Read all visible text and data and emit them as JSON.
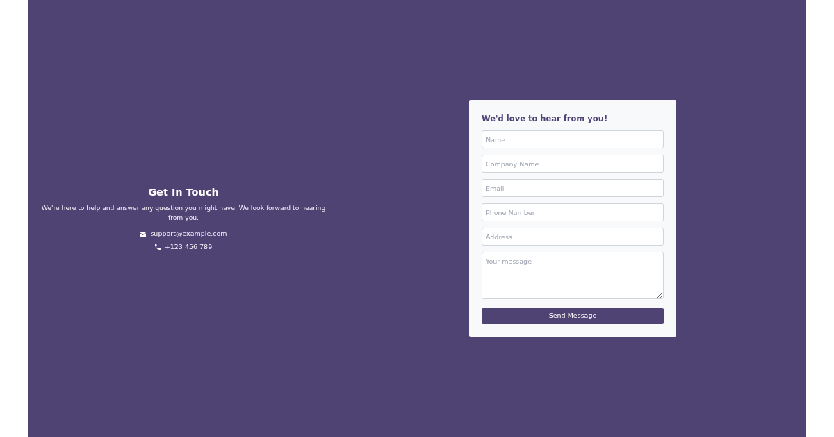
{
  "contact": {
    "title": "Get In Touch",
    "description": "We're here to help and answer any question you might have. We look forward to hearing from you.",
    "email": "support@example.com",
    "phone": "+123 456 789"
  },
  "form": {
    "title": "We'd love to hear from you!",
    "fields": [
      {
        "kind": "input",
        "placeholder": "Name"
      },
      {
        "kind": "input",
        "placeholder": "Company Name"
      },
      {
        "kind": "input",
        "placeholder": "Email"
      },
      {
        "kind": "input",
        "placeholder": "Phone Number"
      },
      {
        "kind": "input",
        "placeholder": "Address"
      },
      {
        "kind": "textarea",
        "placeholder": "Your message"
      }
    ],
    "submit": "Send Message"
  }
}
